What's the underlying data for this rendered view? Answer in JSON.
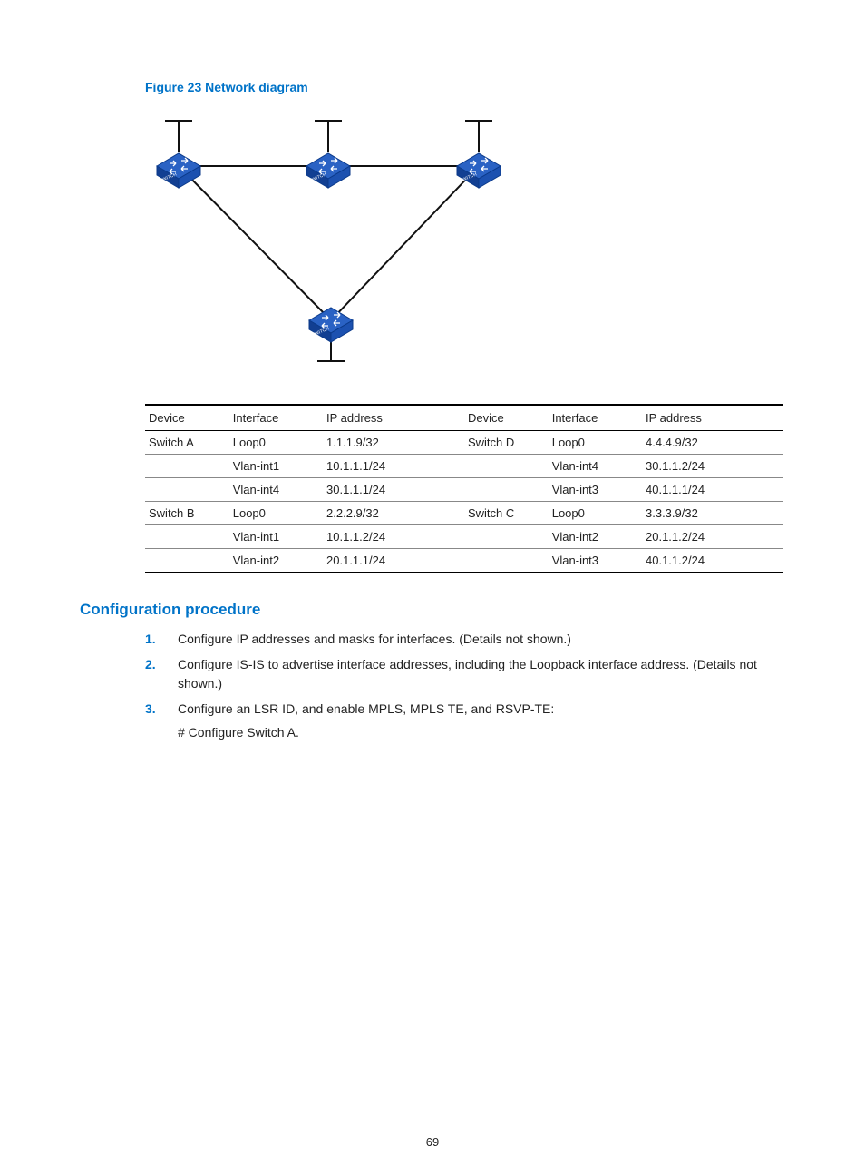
{
  "figure_title": "Figure 23 Network diagram",
  "diagram": {
    "switches": [
      "SWITCH",
      "SWITCH",
      "SWITCH",
      "SWITCH"
    ]
  },
  "table": {
    "headers_left": {
      "device": "Device",
      "interface": "Interface",
      "ip": "IP address"
    },
    "headers_right": {
      "device": "Device",
      "interface": "Interface",
      "ip": "IP address"
    },
    "rows": [
      {
        "l_dev": "Switch A",
        "l_if": "Loop0",
        "l_ip": "1.1.1.9/32",
        "r_dev": "Switch D",
        "r_if": "Loop0",
        "r_ip": "4.4.4.9/32"
      },
      {
        "l_dev": "",
        "l_if": "Vlan-int1",
        "l_ip": "10.1.1.1/24",
        "r_dev": "",
        "r_if": "Vlan-int4",
        "r_ip": "30.1.1.2/24"
      },
      {
        "l_dev": "",
        "l_if": "Vlan-int4",
        "l_ip": "30.1.1.1/24",
        "r_dev": "",
        "r_if": "Vlan-int3",
        "r_ip": "40.1.1.1/24"
      },
      {
        "l_dev": "Switch B",
        "l_if": "Loop0",
        "l_ip": "2.2.2.9/32",
        "r_dev": "Switch C",
        "r_if": "Loop0",
        "r_ip": "3.3.3.9/32"
      },
      {
        "l_dev": "",
        "l_if": "Vlan-int1",
        "l_ip": "10.1.1.2/24",
        "r_dev": "",
        "r_if": "Vlan-int2",
        "r_ip": "20.1.1.2/24"
      },
      {
        "l_dev": "",
        "l_if": "Vlan-int2",
        "l_ip": "20.1.1.1/24",
        "r_dev": "",
        "r_if": "Vlan-int3",
        "r_ip": "40.1.1.2/24"
      }
    ]
  },
  "section_heading": "Configuration procedure",
  "steps": [
    {
      "text": "Configure IP addresses and masks for interfaces. (Details not shown.)"
    },
    {
      "text": "Configure IS-IS to advertise interface addresses, including the Loopback interface address. (Details not shown.)"
    },
    {
      "text": "Configure an LSR ID, and enable MPLS, MPLS TE, and RSVP-TE:",
      "sub": "# Configure Switch A."
    }
  ],
  "page_number": "69"
}
